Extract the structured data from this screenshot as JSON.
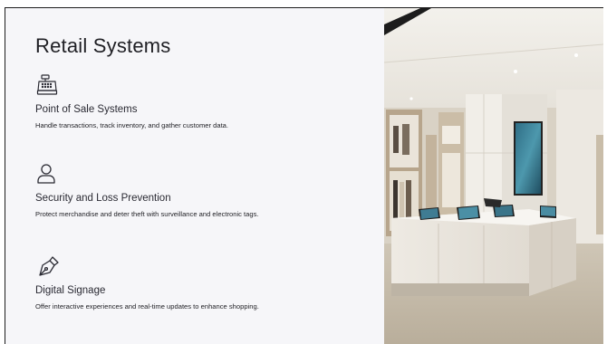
{
  "slide": {
    "title": "Retail Systems",
    "features": [
      {
        "icon": "cash-register-icon",
        "name": "Point of Sale Systems",
        "description": "Handle transactions, track inventory, and gather customer data."
      },
      {
        "icon": "person-icon",
        "name": "Security and Loss Prevention",
        "description": "Protect merchandise and deter theft with surveillance and electronic tags."
      },
      {
        "icon": "pen-nib-icon",
        "name": "Digital Signage",
        "description": "Offer interactive experiences and real-time updates to enhance shopping."
      }
    ]
  },
  "colors": {
    "background": "#f6f6f9",
    "text": "#1f1f24"
  }
}
